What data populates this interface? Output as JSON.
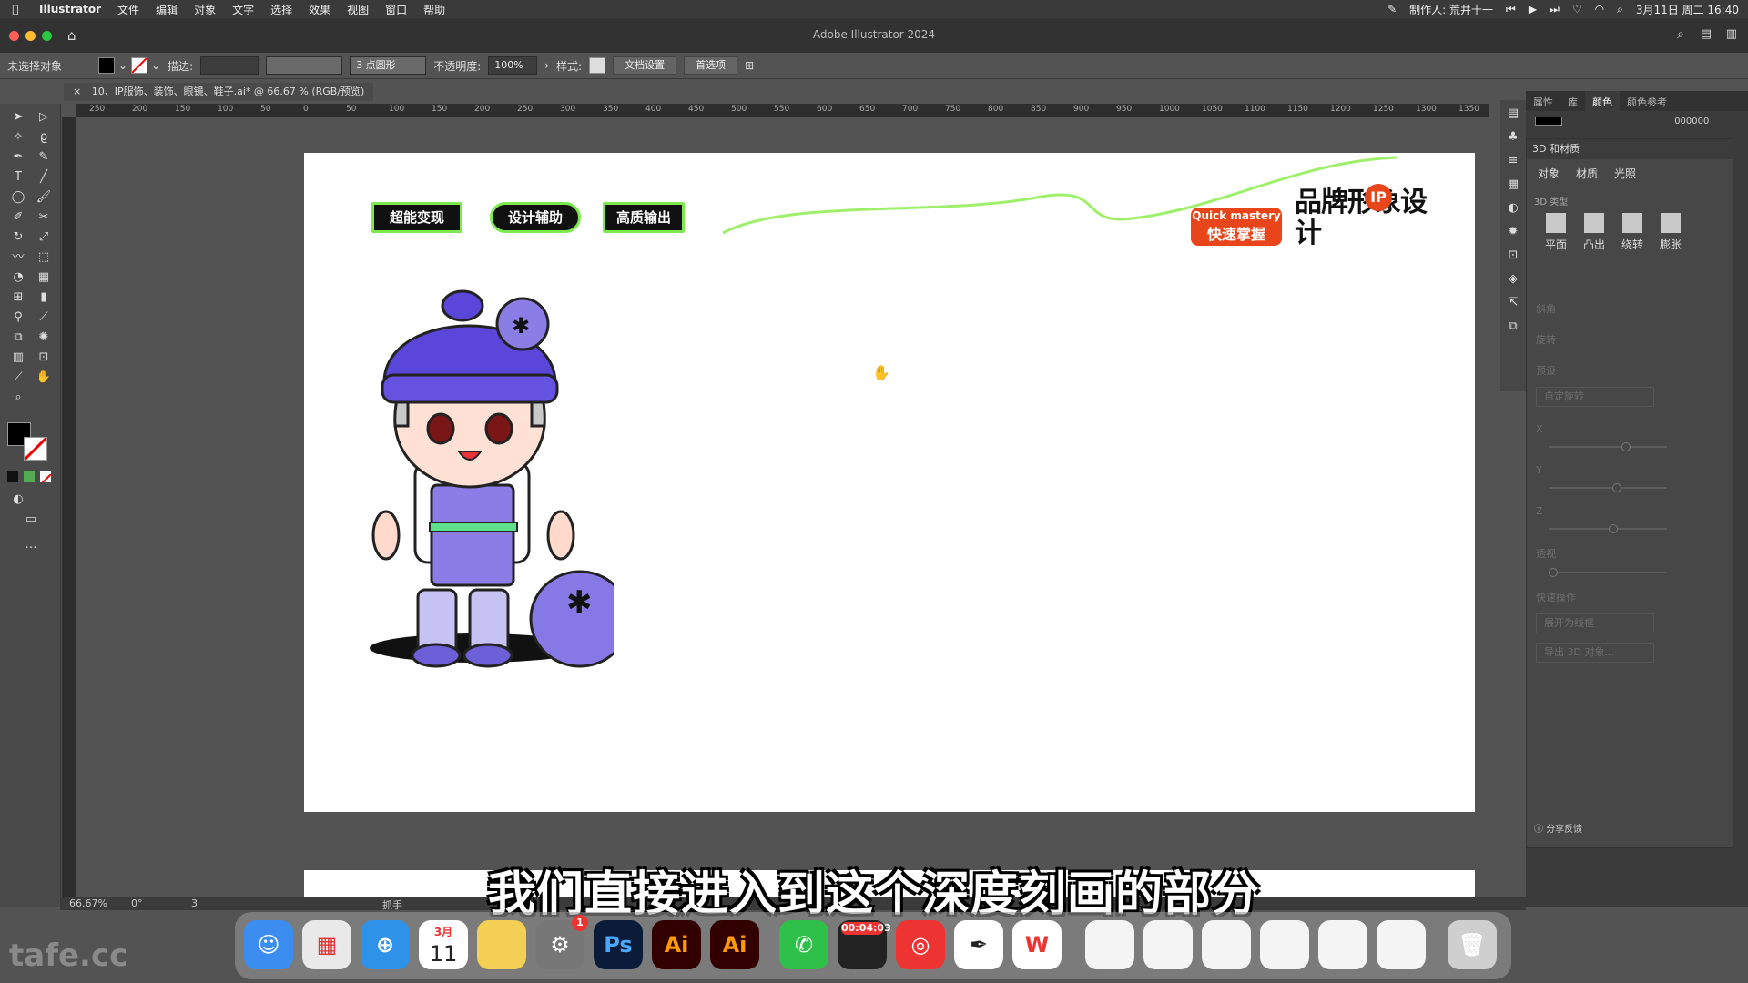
{
  "menubar": {
    "app": "Illustrator",
    "items": [
      "文件",
      "编辑",
      "对象",
      "文字",
      "选择",
      "效果",
      "视图",
      "窗口",
      "帮助"
    ],
    "author": "制作人: 荒井十一",
    "datetime": "3月11日 周二 16:40"
  },
  "window": {
    "title": "Adobe Illustrator 2024"
  },
  "controlbar": {
    "selection": "未选择对象",
    "stroke_label": "描边:",
    "brush": "3 点圆形",
    "opacity_label": "不透明度:",
    "opacity": "100%",
    "style_label": "样式:",
    "doc_setup": "文档设置",
    "prefs": "首选项"
  },
  "doc_tab": {
    "close": "×",
    "title": "10、IP服饰、装饰、眼镜、鞋子.ai* @ 66.67 % (RGB/预览)"
  },
  "ruler_labels": [
    "250",
    "200",
    "150",
    "100",
    "50",
    "0",
    "50",
    "100",
    "150",
    "200",
    "250",
    "300",
    "350",
    "400",
    "450",
    "500",
    "550",
    "600",
    "650",
    "700",
    "750",
    "800",
    "850",
    "900",
    "950",
    "1000",
    "1050",
    "1100",
    "1150",
    "1200",
    "1250",
    "1300",
    "1350"
  ],
  "artboard": {
    "tags": [
      "超能变现",
      "设计辅助",
      "高质输出"
    ],
    "badge_en": "Quick mastery",
    "badge_zh": "快速掌握",
    "logo": "品牌形象设计"
  },
  "right_panel": {
    "tabs": [
      "属性",
      "库",
      "颜色",
      "颜色参考"
    ],
    "hex": "000000",
    "panel_title": "3D 和材质",
    "subtabs": [
      "对象",
      "材质",
      "光照"
    ],
    "section_type": "3D 类型",
    "types": [
      "平面",
      "凸出",
      "绕转",
      "膨胀"
    ],
    "depth_label": "斜角",
    "rotation_label": "旋转",
    "preset_label": "预设",
    "preset_value": "自定旋转",
    "axes": [
      "X",
      "Y",
      "Z"
    ],
    "perspective_label": "透视",
    "quick_actions_label": "快速操作",
    "action1": "展开为线框",
    "action2": "导出 3D 对象...",
    "feedback": "分享反馈"
  },
  "statusbar": {
    "zoom": "66.67%",
    "angle": "0°",
    "artboard_num": "3",
    "tool": "抓手"
  },
  "subtitle": "我们直接进入到这个深度刻画的部分",
  "dock": {
    "calendar_month": "3月",
    "calendar_day": "11",
    "settings_badge": "1",
    "timer": "00:04:03",
    "ps": "Ps",
    "ai": "Ai"
  },
  "watermark": "tafe.cc"
}
